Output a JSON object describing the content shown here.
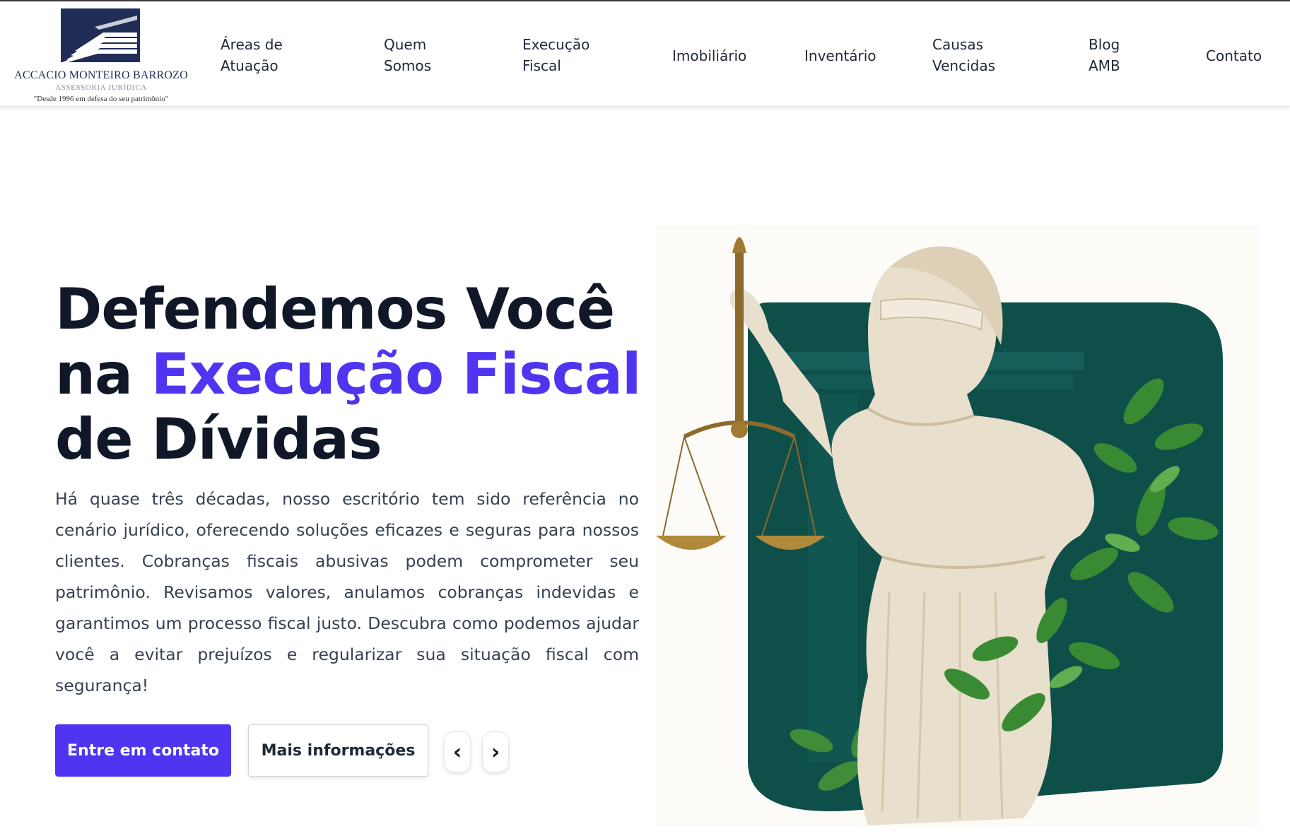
{
  "header": {
    "logo": {
      "name": "ACCACIO MONTEIRO BARROZO",
      "subtitle": "ASSESSORIA JURÍDICA",
      "tagline": "\"Desde 1996 em defesa do seu patrimônio\""
    },
    "nav": [
      {
        "line1": "Áreas de",
        "line2": "Atuação"
      },
      {
        "line1": "Quem",
        "line2": "Somos"
      },
      {
        "line1": "Execução",
        "line2": "Fiscal"
      },
      {
        "line1": "Imobiliário",
        "line2": ""
      },
      {
        "line1": "Inventário",
        "line2": ""
      },
      {
        "line1": "Causas",
        "line2": "Vencidas"
      },
      {
        "line1": "Blog",
        "line2": "AMB"
      },
      {
        "line1": "Contato",
        "line2": ""
      }
    ]
  },
  "hero": {
    "headline_part1": "Defendemos Você",
    "headline_part2": "na ",
    "headline_accent": "Execução Fiscal",
    "headline_part3": "de Dívidas",
    "lead": "Há quase três décadas, nosso escritório tem sido referência no cenário jurídico, oferecendo soluções eficazes e seguras para nossos clientes. Cobranças fiscais abusivas podem comprometer seu patrimônio. Revisamos valores, anulamos cobranças indevidas e garantimos um processo fiscal justo. Descubra como podemos ajudar você a evitar prejuízos e regularizar sua situação fiscal com segurança!",
    "primary_button": "Entre em contato",
    "secondary_button": "Mais informações",
    "prev_arrow": "‹",
    "next_arrow": "›"
  },
  "colors": {
    "accent": "#4f35f0",
    "heading": "#101828",
    "panel_green": "#0f4f4a",
    "logo_navy": "#1f2d57"
  },
  "icons": [
    "logo-building-icon",
    "chevron-left-icon",
    "chevron-right-icon"
  ]
}
